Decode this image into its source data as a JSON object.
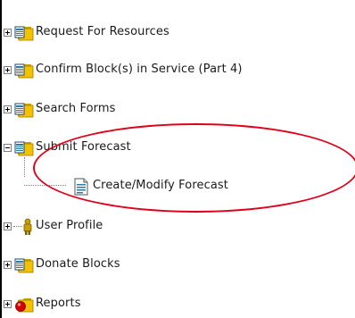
{
  "tree": {
    "items": [
      {
        "label": "Request For Resources",
        "expander": "plus",
        "icon": "folder-form-icon"
      },
      {
        "label": "Confirm Block(s) in Service (Part 4)",
        "expander": "plus",
        "icon": "folder-form-icon"
      },
      {
        "label": "Search Forms",
        "expander": "plus",
        "icon": "folder-form-icon"
      },
      {
        "label": "Submit Forecast",
        "expander": "minus",
        "icon": "folder-form-icon",
        "children": [
          {
            "label": "Create/Modify Forecast",
            "icon": "form-document-icon"
          }
        ]
      },
      {
        "label": "User Profile",
        "expander": "plus",
        "icon": "user-icon"
      },
      {
        "label": "Donate Blocks",
        "expander": "plus",
        "icon": "folder-form-icon"
      },
      {
        "label": "Reports",
        "expander": "plus",
        "icon": "folder-reports-icon"
      }
    ]
  },
  "colors": {
    "highlight_ellipse": "#e0001a",
    "folder": "#f2c200"
  }
}
